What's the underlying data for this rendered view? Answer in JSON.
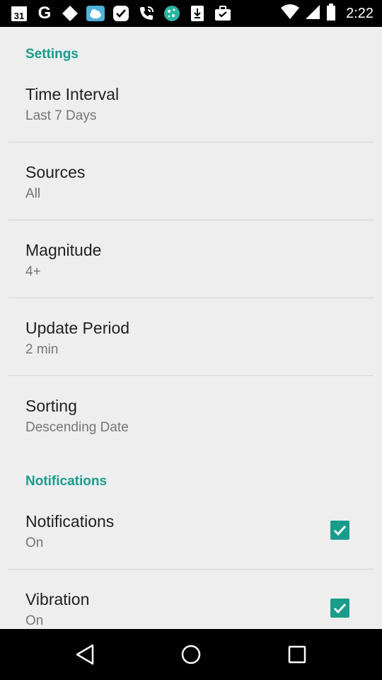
{
  "status_bar": {
    "time": "2:22",
    "calendar_day": "31",
    "google_letter": "G",
    "icons": [
      "calendar-icon",
      "google-icon",
      "diamond-icon",
      "cloud-icon",
      "check-bubble-icon",
      "phone-wifi-icon",
      "globe-icon",
      "download-icon",
      "briefcase-icon",
      "wifi-icon",
      "signal-icon",
      "battery-icon"
    ]
  },
  "settings": {
    "header": "Settings",
    "items": [
      {
        "title": "Time Interval",
        "summary": "Last 7 Days"
      },
      {
        "title": "Sources",
        "summary": "All"
      },
      {
        "title": "Magnitude",
        "summary": "4+"
      },
      {
        "title": "Update Period",
        "summary": "2 min"
      },
      {
        "title": "Sorting",
        "summary": "Descending Date"
      }
    ]
  },
  "notifications": {
    "header": "Notifications",
    "items": [
      {
        "title": "Notifications",
        "summary": "On",
        "checked": true
      },
      {
        "title": "Vibration",
        "summary": "On",
        "checked": true
      }
    ]
  },
  "colors": {
    "accent": "#1a9c8c",
    "background": "#eeeeee",
    "title_text": "#212121",
    "summary_text": "#757575"
  },
  "nav_bar": {
    "icons": [
      "back-icon",
      "home-icon",
      "recents-icon"
    ]
  }
}
